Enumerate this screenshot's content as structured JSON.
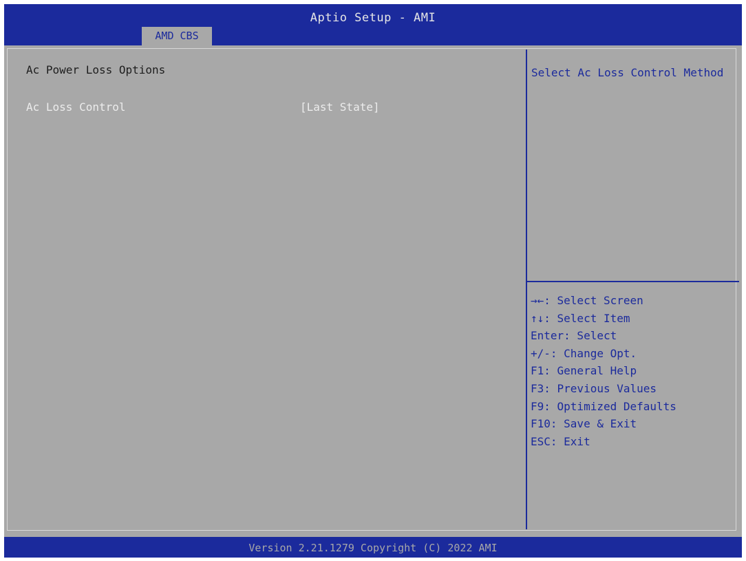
{
  "header": {
    "title": "Aptio Setup - AMI",
    "tab": "AMD CBS"
  },
  "main": {
    "section_title": "Ac Power Loss Options",
    "setting": {
      "label": "Ac Loss Control",
      "value": "[Last State]"
    }
  },
  "help": {
    "text": "Select Ac Loss Control Method"
  },
  "keys": [
    "→←: Select Screen",
    "↑↓: Select Item",
    "Enter: Select",
    "+/-: Change Opt.",
    "F1: General Help",
    "F3: Previous Values",
    "F9: Optimized Defaults",
    "F10: Save & Exit",
    "ESC: Exit"
  ],
  "footer": {
    "text": "Version 2.21.1279 Copyright (C) 2022 AMI"
  },
  "colors": {
    "bios_blue": "#1b2a9c",
    "panel_gray": "#a8a8a8",
    "selected_text": "#ececec"
  }
}
